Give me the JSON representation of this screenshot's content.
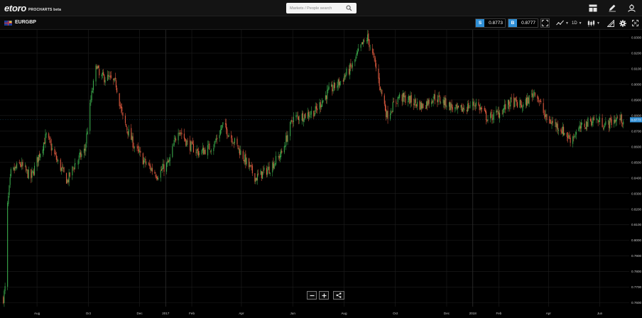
{
  "app": {
    "logo_word": "etoro",
    "logo_sub": "PROCHARTS beta"
  },
  "search": {
    "placeholder": "Markets / People search"
  },
  "top_icons": [
    "layout-icon",
    "pencil-icon",
    "account-icon"
  ],
  "instrument": {
    "symbol": "EURGBP",
    "sell_label": "S",
    "sell_price": "0.8773",
    "buy_label": "B",
    "buy_price": "0.8777",
    "timeframe": "1D",
    "toolbar_icons": [
      "expand-icon",
      "indicators-icon",
      "candles-icon",
      "drawing-icon",
      "settings-icon",
      "fullscreen-icon"
    ]
  },
  "colors": {
    "up": "#3aa84b",
    "down": "#e05a3f",
    "accent": "#2f8fd6",
    "grid": "#1e1e1e"
  },
  "chart_data": {
    "type": "candlestick",
    "symbol": "EURGBP",
    "interval": "1D",
    "x_ticks": [
      "Aug",
      "Oct",
      "Dec",
      "2017",
      "Feb",
      "Apr",
      "Jun",
      "Aug",
      "Oct",
      "Dec",
      "2018",
      "Feb",
      "Apr",
      "Jun"
    ],
    "y_ticks": [
      "0.9300",
      "0.9200",
      "0.9100",
      "0.9000",
      "0.8900",
      "0.8800",
      "0.8700",
      "0.8600",
      "0.8500",
      "0.8400",
      "0.8300",
      "0.8200",
      "0.8100",
      "0.8000",
      "0.7900",
      "0.7800",
      "0.7700",
      "0.7600"
    ],
    "ylim": [
      0.7575,
      0.935
    ],
    "current_price": "0.8773",
    "trend": {
      "dates": [
        "2016-06-22",
        "2016-06-24",
        "2016-06-27",
        "2016-07-01",
        "2016-07-12",
        "2016-07-25",
        "2016-08-03",
        "2016-08-12",
        "2016-08-24",
        "2016-09-06",
        "2016-09-15",
        "2016-09-27",
        "2016-10-04",
        "2016-10-11",
        "2016-10-14",
        "2016-10-25",
        "2016-11-03",
        "2016-11-11",
        "2016-11-25",
        "2016-12-07",
        "2016-12-22",
        "2017-01-05",
        "2017-01-16",
        "2017-01-27",
        "2017-02-10",
        "2017-02-27",
        "2017-03-10",
        "2017-03-24",
        "2017-04-07",
        "2017-04-18",
        "2017-05-04",
        "2017-05-19",
        "2017-06-01",
        "2017-06-14",
        "2017-06-28",
        "2017-07-13",
        "2017-07-28",
        "2017-08-11",
        "2017-08-21",
        "2017-08-29",
        "2017-09-06",
        "2017-09-14",
        "2017-09-21",
        "2017-10-05",
        "2017-10-18",
        "2017-11-02",
        "2017-11-16",
        "2017-11-30",
        "2017-12-14",
        "2018-01-05",
        "2018-01-19",
        "2018-02-02",
        "2018-02-16",
        "2018-03-02",
        "2018-03-16",
        "2018-03-29",
        "2018-04-13",
        "2018-04-27",
        "2018-05-11",
        "2018-05-25",
        "2018-06-08",
        "2018-06-21",
        "2018-06-29"
      ],
      "values": [
        0.763,
        0.769,
        0.822,
        0.843,
        0.849,
        0.84,
        0.854,
        0.867,
        0.852,
        0.838,
        0.849,
        0.858,
        0.89,
        0.913,
        0.905,
        0.904,
        0.9,
        0.878,
        0.86,
        0.85,
        0.842,
        0.85,
        0.872,
        0.862,
        0.856,
        0.861,
        0.874,
        0.863,
        0.85,
        0.84,
        0.846,
        0.856,
        0.878,
        0.88,
        0.883,
        0.895,
        0.902,
        0.912,
        0.924,
        0.93,
        0.915,
        0.896,
        0.88,
        0.892,
        0.89,
        0.886,
        0.892,
        0.888,
        0.883,
        0.888,
        0.878,
        0.882,
        0.889,
        0.886,
        0.896,
        0.878,
        0.873,
        0.865,
        0.873,
        0.878,
        0.874,
        0.878,
        0.8773
      ]
    },
    "grid": true,
    "legend": "none"
  }
}
